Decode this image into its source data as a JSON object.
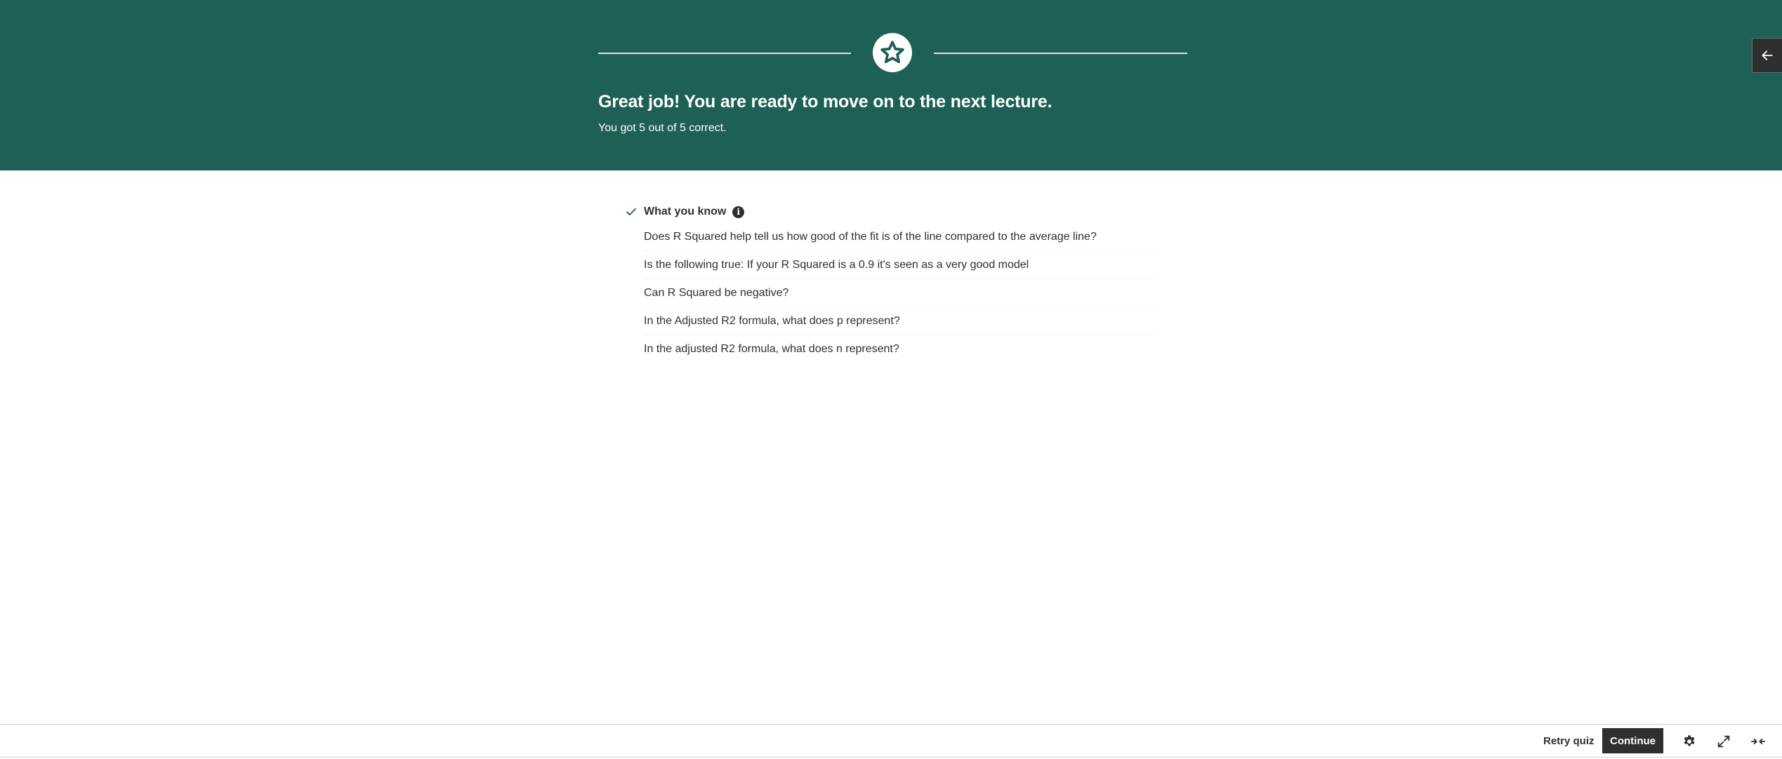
{
  "result": {
    "title": "Great job! You are ready to move on to the next lecture.",
    "subtitle": "You got 5 out of 5 correct.",
    "icon": "star-icon"
  },
  "side_panel": {
    "icon": "arrow-left-icon"
  },
  "summary": {
    "title": "What you know",
    "questions": [
      "Does R Squared help tell us how good of the fit is of the line compared to the average line?",
      "Is the following true: If your R Squared is a 0.9 it's seen as a very good model",
      "Can R Squared be negative?",
      "In the Adjusted R2 formula, what does p represent?",
      "In the adjusted R2 formula, what does n represent?"
    ]
  },
  "footer": {
    "retry_label": "Retry quiz",
    "continue_label": "Continue",
    "icons": [
      "gear-icon",
      "expand-icon",
      "collapse-icon"
    ]
  },
  "colors": {
    "banner": "#1e5f56",
    "accent_green": "#1e6055",
    "button_dark": "#2d2f31"
  }
}
